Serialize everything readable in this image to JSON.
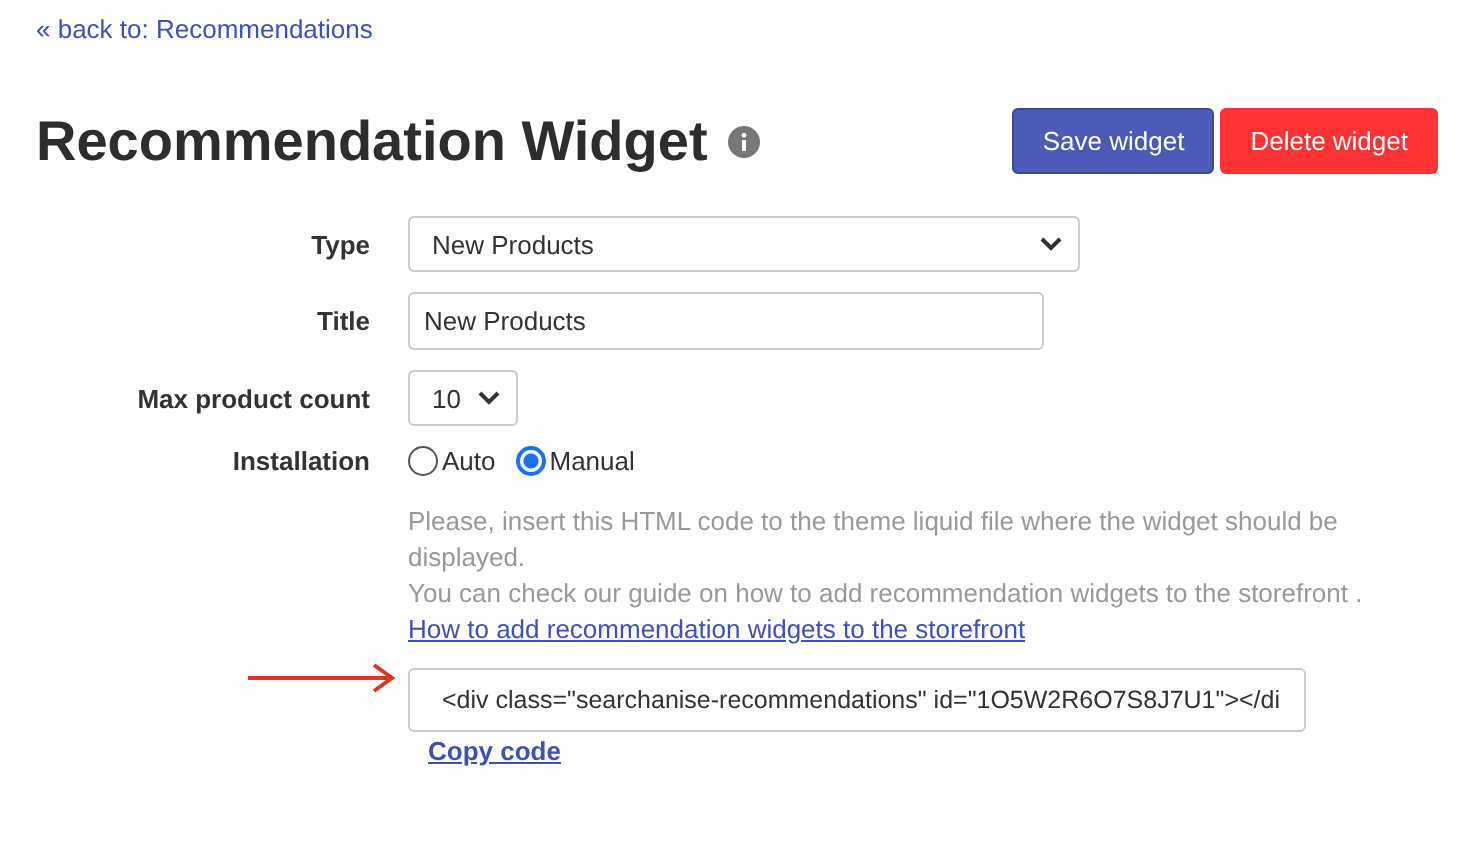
{
  "back_link": "« back to: Recommendations",
  "page_title": "Recommendation Widget",
  "header_buttons": [
    {
      "label": "Save widget",
      "kind": "primary"
    },
    {
      "label": "Delete widget",
      "kind": "danger"
    }
  ],
  "form": {
    "type": {
      "label": "Type",
      "value": "New Products"
    },
    "title": {
      "label": "Title",
      "value": "New Products"
    },
    "max_count": {
      "label": "Max product count",
      "value": "10"
    },
    "installation": {
      "label": "Installation",
      "options": [
        {
          "label": "Auto",
          "selected": false
        },
        {
          "label": "Manual",
          "selected": true
        }
      ]
    },
    "help_lines": [
      "Please, insert this HTML code to the theme liquid file where the widget should be displayed.",
      "You can check our guide on how to add recommendation widgets to the storefront ."
    ],
    "guide_link": "How to add recommendation widgets to the storefront",
    "code": "<div class=\"searchanise-recommendations\" id=\"1O5W2R6O7S8J7U1\"></di",
    "copy_link": "Copy code"
  }
}
